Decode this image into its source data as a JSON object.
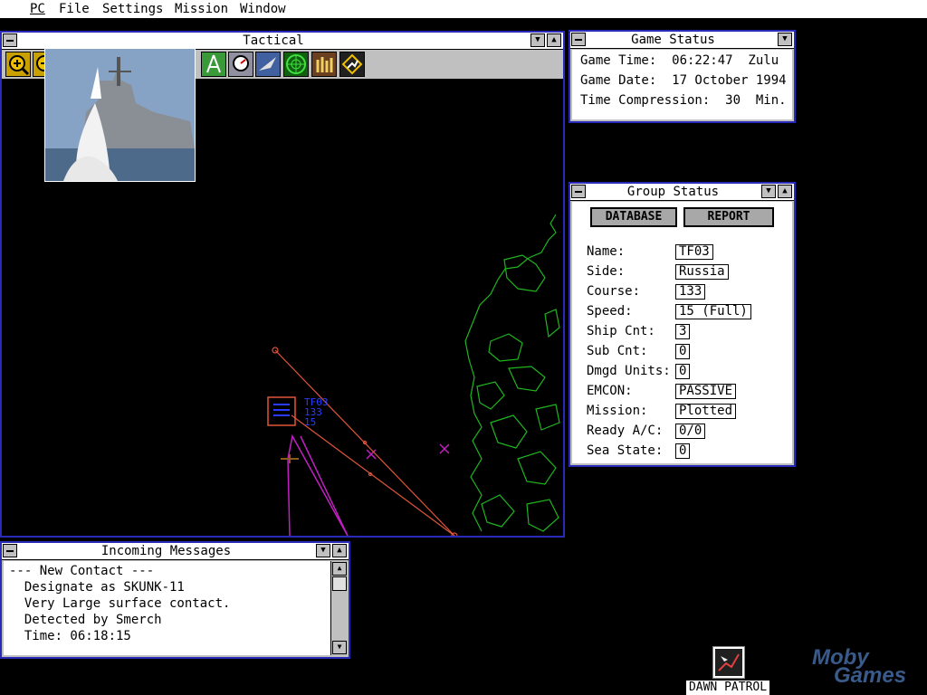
{
  "menu": [
    "PC",
    "File",
    "Settings",
    "Mission",
    "Window"
  ],
  "tactical": {
    "title": "Tactical",
    "contact_label_lines": [
      "TF03",
      "133",
      "15"
    ]
  },
  "game_status": {
    "title": "Game Status",
    "rows": [
      "Game Time:  06:22:47  Zulu",
      "Game Date:  17 October 1994",
      "Time Compression:  30  Min."
    ]
  },
  "group_status": {
    "title": "Group Status",
    "database_label": "DATABASE",
    "report_label": "REPORT",
    "fields": [
      {
        "label": "Name:",
        "value": "TF03"
      },
      {
        "label": "Side:",
        "value": "Russia"
      },
      {
        "label": "Course:",
        "value": "133"
      },
      {
        "label": "Speed:",
        "value": "15 (Full)"
      },
      {
        "label": "Ship Cnt:",
        "value": "3"
      },
      {
        "label": "Sub Cnt:",
        "value": "0"
      },
      {
        "label": "Dmgd Units:",
        "value": "0"
      },
      {
        "label": "EMCON:",
        "value": "PASSIVE"
      },
      {
        "label": "Mission:",
        "value": "Plotted"
      },
      {
        "label": "Ready A/C:",
        "value": "0/0"
      },
      {
        "label": "Sea State:",
        "value": "0"
      }
    ]
  },
  "messages": {
    "title": "Incoming Messages",
    "lines": [
      "--- New Contact ---",
      "  Designate as SKUNK-11",
      "  Very Large surface contact.",
      "  Detected by Smerch",
      "  Time: 06:18:15"
    ]
  },
  "desktop_icon": {
    "label": "DAWN PATROL"
  },
  "watermark": {
    "line1": "Moby",
    "line2": "Games"
  },
  "colors": {
    "window_border": "#2a2ab8",
    "land": "#1fb51f",
    "track": "#e0553a",
    "own_group": "#2a3cff",
    "magenta": "#c020c0"
  }
}
